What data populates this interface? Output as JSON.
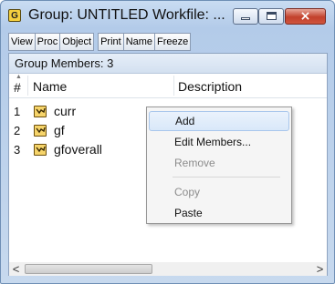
{
  "window": {
    "title": "Group: UNTITLED   Workfile: ...",
    "app_icon_letter": "G",
    "controls": {
      "minimize": "minimize",
      "maximize": "maximize",
      "close": "×"
    }
  },
  "toolbar": {
    "buttons": [
      "View",
      "Proc",
      "Object",
      "Print",
      "Name",
      "Freeze"
    ]
  },
  "status": {
    "text": "Group Members: 3"
  },
  "table": {
    "headers": {
      "num": "#",
      "name": "Name",
      "description": "Description"
    },
    "rows": [
      {
        "num": "1",
        "name": "curr",
        "icon": "series-icon"
      },
      {
        "num": "2",
        "name": "gf",
        "icon": "series-icon"
      },
      {
        "num": "3",
        "name": "gfoverall",
        "icon": "series-icon"
      }
    ]
  },
  "scrollbar": {
    "left_arrow": "<",
    "right_arrow": ">"
  },
  "context_menu": {
    "items": [
      {
        "label": "Add",
        "state": "highlighted"
      },
      {
        "label": "Edit Members...",
        "state": "enabled"
      },
      {
        "label": "Remove",
        "state": "disabled"
      },
      {
        "label": "Copy",
        "state": "disabled"
      },
      {
        "label": "Paste",
        "state": "enabled"
      }
    ]
  },
  "colors": {
    "title_gradient": "#b3cbe9",
    "close_button": "#c2412c",
    "series_icon": "#f6d46a",
    "menu_highlight": "#d9e8f9"
  }
}
